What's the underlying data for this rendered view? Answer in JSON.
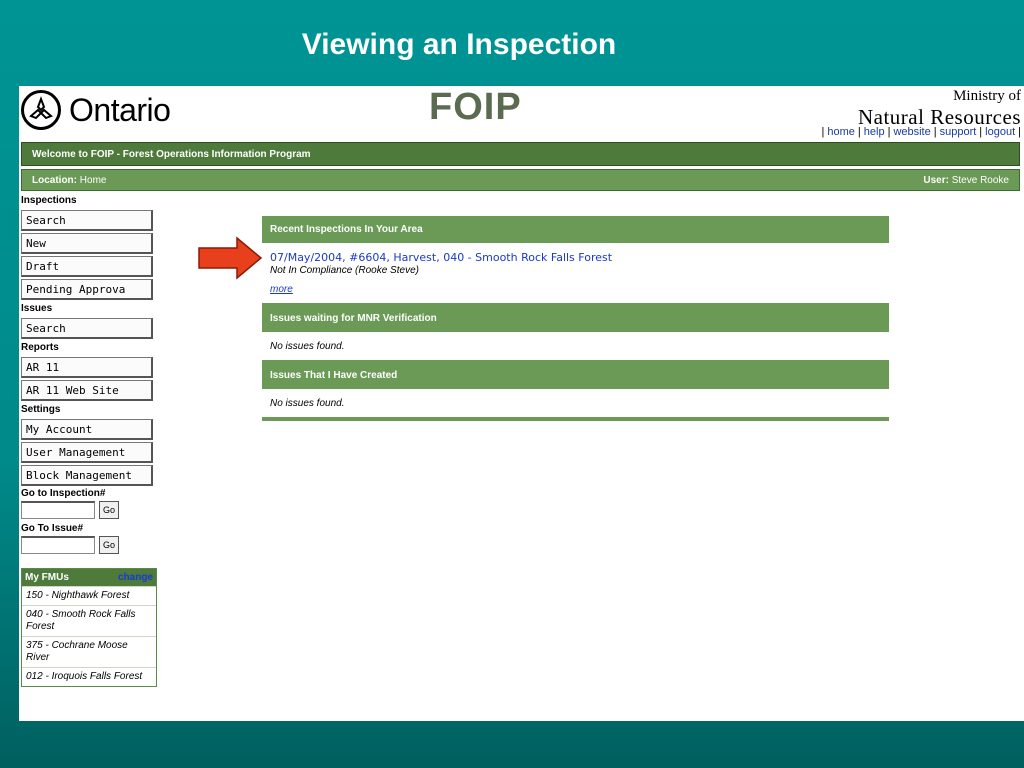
{
  "slide": {
    "title": "Viewing an Inspection"
  },
  "header": {
    "logo_text": "Ontario",
    "app_name": "FOIP",
    "ministry_line1": "Ministry of",
    "ministry_line2": "Natural Resources",
    "links": [
      "home",
      "help",
      "website",
      "support",
      "logout"
    ]
  },
  "welcome_bar": {
    "text": "Welcome to FOIP - Forest Operations Information Program"
  },
  "location_bar": {
    "location_label": "Location:",
    "location_value": "Home",
    "user_label": "User:",
    "user_value": "Steve Rooke"
  },
  "sidebar": {
    "inspections_heading": "Inspections",
    "inspections_items": [
      "Search",
      "New",
      "Draft",
      "Pending Approva"
    ],
    "issues_heading": "Issues",
    "issues_items": [
      "Search"
    ],
    "reports_heading": "Reports",
    "reports_items": [
      "AR 11",
      "AR 11 Web Site"
    ],
    "settings_heading": "Settings",
    "settings_items": [
      "My Account",
      "User Management",
      "Block Management"
    ],
    "goto_inspection_label": "Go to Inspection#",
    "goto_issue_label": "Go To Issue#",
    "go_label": "Go"
  },
  "fmus": {
    "heading": "My FMUs",
    "change_label": "change",
    "items": [
      "150 - Nighthawk Forest",
      "040 - Smooth Rock Falls Forest",
      "375 - Cochrane Moose River",
      "012 - Iroquois Falls Forest"
    ]
  },
  "main": {
    "recent_heading": "Recent Inspections In Your Area",
    "recent_link": "07/May/2004, #6604, Harvest, 040 - Smooth Rock Falls Forest",
    "recent_status": "Not In Compliance (Rooke Steve)",
    "more_label": "more",
    "waiting_heading": "Issues waiting for MNR Verification",
    "waiting_text": "No issues found.",
    "created_heading": "Issues That I Have Created",
    "created_text": "No issues found."
  },
  "colors": {
    "accent_green": "#4e7a3c",
    "arrow_red": "#e8401c",
    "slide_bg": "#009494"
  }
}
